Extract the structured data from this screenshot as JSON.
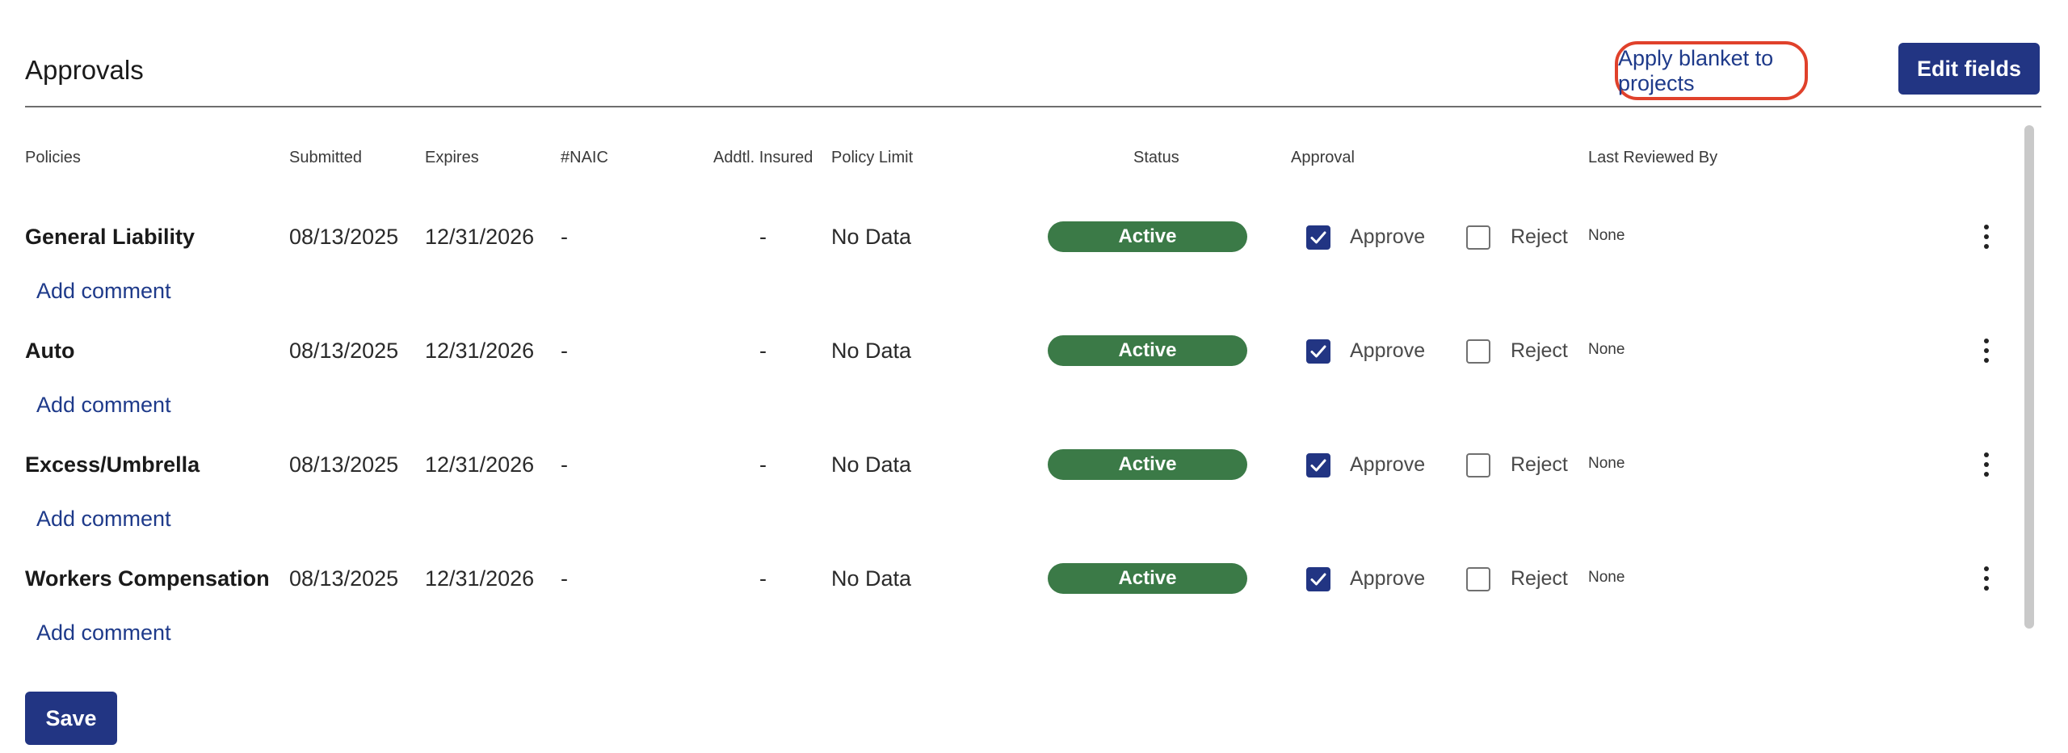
{
  "section": {
    "title": "Approvals",
    "apply_blanket_label": "Apply blanket to projects",
    "edit_fields_label": "Edit fields"
  },
  "columns": {
    "policies": "Policies",
    "submitted": "Submitted",
    "expires": "Expires",
    "naic": "#NAIC",
    "addtl_insured": "Addtl. Insured",
    "policy_limit": "Policy Limit",
    "status": "Status",
    "approval": "Approval",
    "last_reviewed_by": "Last Reviewed By"
  },
  "rows": [
    {
      "policy": "General Liability",
      "submitted": "08/13/2025",
      "expires": "12/31/2026",
      "naic": "-",
      "addtl_insured": "-",
      "policy_limit": "No Data",
      "status": "Active",
      "approve_label": "Approve",
      "approved": true,
      "reject_label": "Reject",
      "rejected": false,
      "reviewer": "None",
      "add_comment": "Add comment"
    },
    {
      "policy": "Auto",
      "submitted": "08/13/2025",
      "expires": "12/31/2026",
      "naic": "-",
      "addtl_insured": "-",
      "policy_limit": "No Data",
      "status": "Active",
      "approve_label": "Approve",
      "approved": true,
      "reject_label": "Reject",
      "rejected": false,
      "reviewer": "None",
      "add_comment": "Add comment"
    },
    {
      "policy": "Excess/Umbrella",
      "submitted": "08/13/2025",
      "expires": "12/31/2026",
      "naic": "-",
      "addtl_insured": "-",
      "policy_limit": "No Data",
      "status": "Active",
      "approve_label": "Approve",
      "approved": true,
      "reject_label": "Reject",
      "rejected": false,
      "reviewer": "None",
      "add_comment": "Add comment"
    },
    {
      "policy": "Workers Compensation",
      "submitted": "08/13/2025",
      "expires": "12/31/2026",
      "naic": "-",
      "addtl_insured": "-",
      "policy_limit": "No Data",
      "status": "Active",
      "approve_label": "Approve",
      "approved": true,
      "reject_label": "Reject",
      "rejected": false,
      "reviewer": "None",
      "add_comment": "Add comment"
    }
  ],
  "footer": {
    "save_label": "Save"
  },
  "colors": {
    "primary": "#223583",
    "status_active": "#3b7a47",
    "highlight_ring": "#e0412b",
    "link": "#1e3a8a"
  },
  "icons": {
    "checkbox_checked": "check-icon",
    "row_menu": "kebab-menu-icon"
  }
}
